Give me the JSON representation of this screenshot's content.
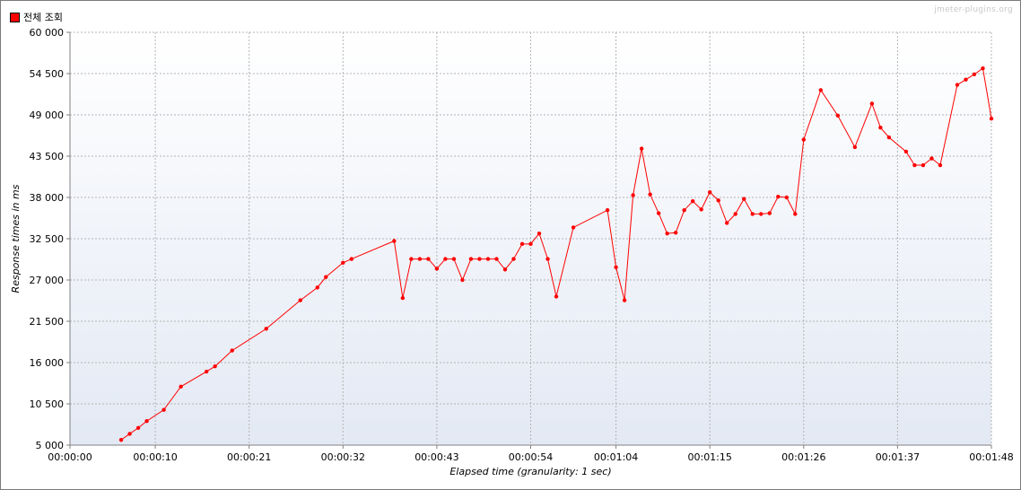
{
  "watermark": "jmeter-plugins.org",
  "chart_data": {
    "type": "line",
    "title": "",
    "xlabel": "Elapsed time (granularity: 1 sec)",
    "ylabel": "Response times in ms",
    "xlim": [
      0,
      108
    ],
    "ylim": [
      5000,
      60000
    ],
    "grid": true,
    "legend": "top-left",
    "x_tick_values": [
      0,
      10,
      21,
      32,
      43,
      54,
      64,
      75,
      86,
      97,
      108
    ],
    "x_tick_labels": [
      "00:00:00",
      "00:00:10",
      "00:00:21",
      "00:00:32",
      "00:00:43",
      "00:00:54",
      "00:01:04",
      "00:01:15",
      "00:01:26",
      "00:01:37",
      "00:01:48"
    ],
    "y_tick_values": [
      5000,
      10500,
      16000,
      21500,
      27000,
      32500,
      38000,
      43500,
      49000,
      54500,
      60000
    ],
    "y_tick_labels": [
      "5 000",
      "10 500",
      "16 000",
      "21 500",
      "27 000",
      "32 500",
      "38 000",
      "43 500",
      "49 000",
      "54 500",
      "60 000"
    ],
    "series": [
      {
        "name": "전체 조회",
        "color": "#ff0000",
        "x": [
          6,
          7,
          8,
          9,
          11,
          13,
          16,
          17,
          19,
          23,
          27,
          29,
          30,
          32,
          33,
          38,
          39,
          40,
          41,
          42,
          43,
          44,
          45,
          46,
          47,
          48,
          49,
          50,
          51,
          52,
          53,
          54,
          55,
          56,
          57,
          59,
          63,
          64,
          65,
          66,
          67,
          68,
          69,
          70,
          71,
          72,
          73,
          74,
          75,
          76,
          77,
          78,
          79,
          80,
          81,
          82,
          83,
          84,
          85,
          86,
          88,
          90,
          92,
          94,
          95,
          96,
          98,
          99,
          100,
          101,
          102,
          104,
          105,
          106,
          107,
          108
        ],
        "y": [
          5700,
          6500,
          7300,
          8200,
          9700,
          12800,
          14800,
          15500,
          17600,
          20500,
          24300,
          26000,
          27400,
          29300,
          29800,
          32200,
          24600,
          29800,
          29800,
          29800,
          28500,
          29800,
          29800,
          27000,
          29800,
          29800,
          29800,
          29800,
          28400,
          29800,
          31800,
          31800,
          33200,
          29800,
          24800,
          34000,
          36300,
          28700,
          24300,
          38300,
          44500,
          38400,
          35900,
          33200,
          33300,
          36300,
          37500,
          36400,
          38700,
          37600,
          34600,
          35800,
          37800,
          35800,
          35800,
          35900,
          38100,
          38000,
          35800,
          45700,
          52300,
          48900,
          44700,
          50500,
          47300,
          46000,
          44100,
          42300,
          42300,
          43200,
          42300,
          53000,
          53700,
          54400,
          55200,
          48500
        ]
      }
    ]
  }
}
